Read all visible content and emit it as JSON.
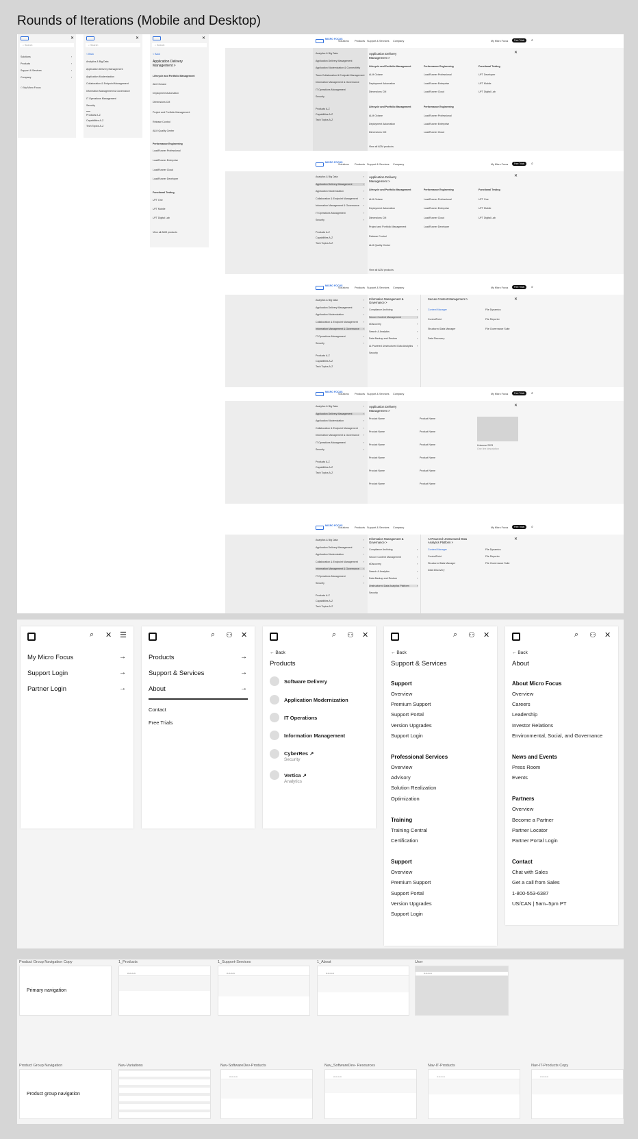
{
  "page_title": "Rounds of Iterations (Mobile and Desktop)",
  "mobile_menus": [
    {
      "search": "Search",
      "items": [
        "Solutions",
        "Products",
        "Support & Services",
        "Company"
      ],
      "account": "My Micro Focus"
    },
    {
      "search": "Search",
      "back": "< Back",
      "items": [
        "Analytics & Big Data",
        "Application Delivery Management",
        "Application Modernization",
        "Collaboration & Endpoint Management",
        "Information Management & Governance",
        "IT Operations Management",
        "Security"
      ],
      "links": [
        "Products A-Z",
        "Capabilities A-Z",
        "Tech Topics A-Z"
      ]
    },
    {
      "search": "Search",
      "back": "< Back",
      "title": "Application Delivery Management >",
      "items": [
        "Lifecycle and Portfolio Management",
        "ALM Octane",
        "Deployment Automation",
        "Dimensions CM",
        "Project and Portfolio Management",
        "Release Control",
        "ALM Quality Center",
        "Performance Engineering",
        "LoadRunner Professional",
        "LoadRunner Enterprise",
        "LoadRunner Cloud",
        "LoadRunner Developer",
        "Functional Testing",
        "UFT One",
        "UFT Mobile",
        "UFT Digital Lab"
      ],
      "view_all": "View all ADM products"
    }
  ],
  "desktop": {
    "brand": "MICRO FOCUS",
    "nav": [
      "Solutions",
      "Products",
      "Support & Services",
      "Company"
    ],
    "account": "My Micro Focus",
    "cta": "Free Trials",
    "close": "✕",
    "categories": [
      "Analytics & Big Data",
      "Application Delivery Management",
      "Application Modernization & Connectivity",
      "Team Collaboration & Endpoint Management",
      "Information Management & Governance",
      "IT Operations Management",
      "Security"
    ],
    "categories_b": [
      "Analytics & Big Data",
      "Application Delivery Management",
      "Application Modernization",
      "Collaboration & Endpoint Management",
      "Information Management & Governance",
      "IT Operations Management",
      "Security"
    ],
    "az": [
      "Products A-Z",
      "Capabilities A-Z",
      "Tech Topics A-Z"
    ],
    "adm_title": "Application Delivery Management >",
    "adm_cols": [
      [
        "Lifecycle and Portfolio Management",
        "ALM Octane",
        "Deployment Automation",
        "Dimensions CM",
        "Lifecycle and Portfolio Management",
        "ALM Octane",
        "Deployment Automation",
        "Dimensions CM"
      ],
      [
        "Performance Engineering",
        "LoadRunner Professional",
        "LoadRunner Enterprise",
        "LoadRunner Cloud",
        "Performance Engineering",
        "LoadRunner Professional",
        "LoadRunner Enterprise",
        "LoadRunner Cloud"
      ],
      [
        "Functional Testing",
        "UFT Developer",
        "UFT Mobile",
        "UFT Digital Lab"
      ]
    ],
    "adm_cols_b": [
      [
        "Lifecycle and Portfolio Management",
        "ALM Octane",
        "Deployment Automation",
        "Dimensions CM",
        "Project and Portfolio Management",
        "Release Control",
        "ALM Quality Center"
      ],
      [
        "Performance Engineering",
        "LoadRunner Professional",
        "LoadRunner Enterprise",
        "LoadRunner Cloud",
        "LoadRunner Developer"
      ],
      [
        "Functional Testing",
        "UFT One",
        "UFT Mobile",
        "UFT Digital Lab"
      ]
    ],
    "view_all": "View all ADM products",
    "img_title": "Governance > ",
    "img_title_a": "Information Management & Governance >",
    "img_sub": [
      "Compliance Archiving",
      "Secure Content Management",
      "eDiscovery",
      "Search & Analytics",
      "Data Backup and Restore",
      "AI-Powered Unstructured Data Analytics",
      "Security"
    ],
    "img_sub_b": [
      "Compliance Archiving",
      "Secure Content Management",
      "eDiscovery",
      "Search & Analytics",
      "Data Backup and Restore",
      "Unstructured Data Analytics Platform",
      "Security"
    ],
    "scm_title": "Secure Content Management >",
    "scm_items": [
      "Content Manager",
      "ControlPoint",
      "Structured Data Manager",
      "Data Discovery"
    ],
    "scm_items_r": [
      "File Dynamics",
      "File Reporter",
      "File Governance Suite"
    ],
    "ai_title": "AI-Powered Unstructured Data Analytics Platform >",
    "product_name": "Product Name",
    "promo": "Universe 2023",
    "promo_sub": "One line description"
  },
  "mobile_v2": {
    "p1": {
      "rows": [
        "My Micro Focus",
        "Support Login",
        "Partner Login"
      ]
    },
    "p2": {
      "rows": [
        "Products",
        "Support & Services",
        "About"
      ],
      "links": [
        "Contact",
        "Free Trials"
      ]
    },
    "p3": {
      "back": "Back",
      "title": "Products",
      "items": [
        {
          "name": "Software Delivery",
          "sub": ""
        },
        {
          "name": "Application Modernization",
          "sub": ""
        },
        {
          "name": "IT Operations",
          "sub": ""
        },
        {
          "name": "Information Management",
          "sub": ""
        },
        {
          "name": "CyberRes ↗",
          "sub": "Security"
        },
        {
          "name": "Vertica ↗",
          "sub": "Analytics"
        }
      ]
    },
    "p4": {
      "back": "Back",
      "title": "Support & Services",
      "groups": [
        {
          "h": "Support",
          "items": [
            "Overview",
            "Premium Support",
            "Support Portal",
            "Version Upgrades",
            "Support Login"
          ]
        },
        {
          "h": "Professional Services",
          "items": [
            "Overview",
            "Advisory",
            "Solution Realization",
            "Optimization"
          ]
        },
        {
          "h": "Training",
          "items": [
            "Training Central",
            "Certification"
          ]
        },
        {
          "h": "Support",
          "items": [
            "Overview",
            "Premium Support",
            "Support Portal",
            "Version Upgrades",
            "Support Login"
          ]
        }
      ]
    },
    "p5": {
      "back": "Back",
      "title": "About",
      "groups": [
        {
          "h": "About Micro Focus",
          "items": [
            "Overview",
            "Careers",
            "Leadership",
            "Investor Relations",
            "Environmental, Social, and Governance"
          ]
        },
        {
          "h": "News and Events",
          "items": [
            "Press Room",
            "Events"
          ]
        },
        {
          "h": "Partners",
          "items": [
            "Overview",
            "Become a Partner",
            "Partner Locator",
            "Partner Portal Login"
          ]
        },
        {
          "h": "Contact",
          "items": [
            "Chat with Sales",
            "Get a call from Sales",
            "1-800-553-6387",
            "US/CAN | 5am–5pm PT"
          ]
        }
      ]
    }
  },
  "frames_row1": {
    "labels": [
      "Product Group Navigation Copy",
      "1_Products",
      "1_Support-Services",
      "1_About",
      "User"
    ],
    "card": "Primary navigation"
  },
  "frames_row2": {
    "labels": [
      "Product Group Navigation",
      "Nav-Variations",
      "Nav-SoftwareDev-Products",
      "Nav_SoftwareDev- Resources",
      "Nav-IT-Products",
      "Nav-IT-Products Copy"
    ],
    "card": "Product group navigation"
  }
}
